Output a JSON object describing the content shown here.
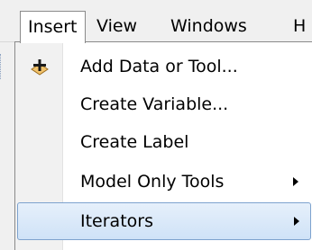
{
  "menubar": {
    "items": [
      {
        "label": "Insert",
        "active": true
      },
      {
        "label": "View",
        "active": false
      },
      {
        "label": "Windows",
        "active": false
      },
      {
        "label": "H",
        "active": false
      }
    ]
  },
  "dropdown": {
    "items": [
      {
        "label": "Add Data or Tool...",
        "icon": "add-data-plus-icon",
        "has_submenu": false
      },
      {
        "label": "Create Variable...",
        "icon": "",
        "has_submenu": false
      },
      {
        "label": "Create Label",
        "icon": "",
        "has_submenu": false
      },
      {
        "label": "Model Only Tools",
        "icon": "",
        "has_submenu": true
      },
      {
        "label": "Iterators",
        "icon": "",
        "has_submenu": true,
        "highlighted": true
      }
    ]
  },
  "colors": {
    "menu_background": "#ffffff",
    "gutter": "#f1f1f1",
    "highlight_border": "#7da2ce",
    "highlight_fill": "#cfe2f7",
    "add_icon_fill": "#f2c36b"
  }
}
